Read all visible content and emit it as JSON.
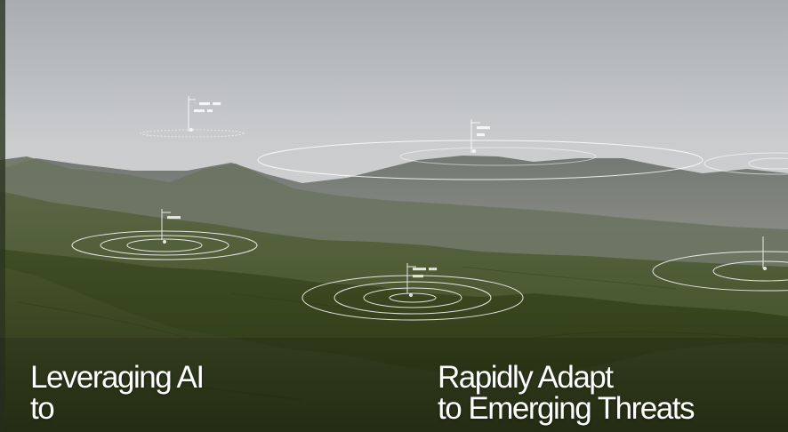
{
  "captions": {
    "left_line1": "Leveraging AI",
    "left_line2": "to",
    "right_line1": "Rapidly Adapt",
    "right_line2": "to Emerging Threats"
  },
  "colors": {
    "sky": "#c4c6c9",
    "distant_ridge": "#7c7f7a",
    "mid_hills": "#56623f",
    "foreground": "#3c4a25",
    "hud_lines": "#ffffff",
    "caption_text": "#ffffff"
  },
  "hud_markers": [
    {
      "name": "marker-sky-left"
    },
    {
      "name": "marker-sky-center"
    },
    {
      "name": "marker-left-hill"
    },
    {
      "name": "marker-center-valley"
    },
    {
      "name": "marker-right-edge"
    }
  ]
}
